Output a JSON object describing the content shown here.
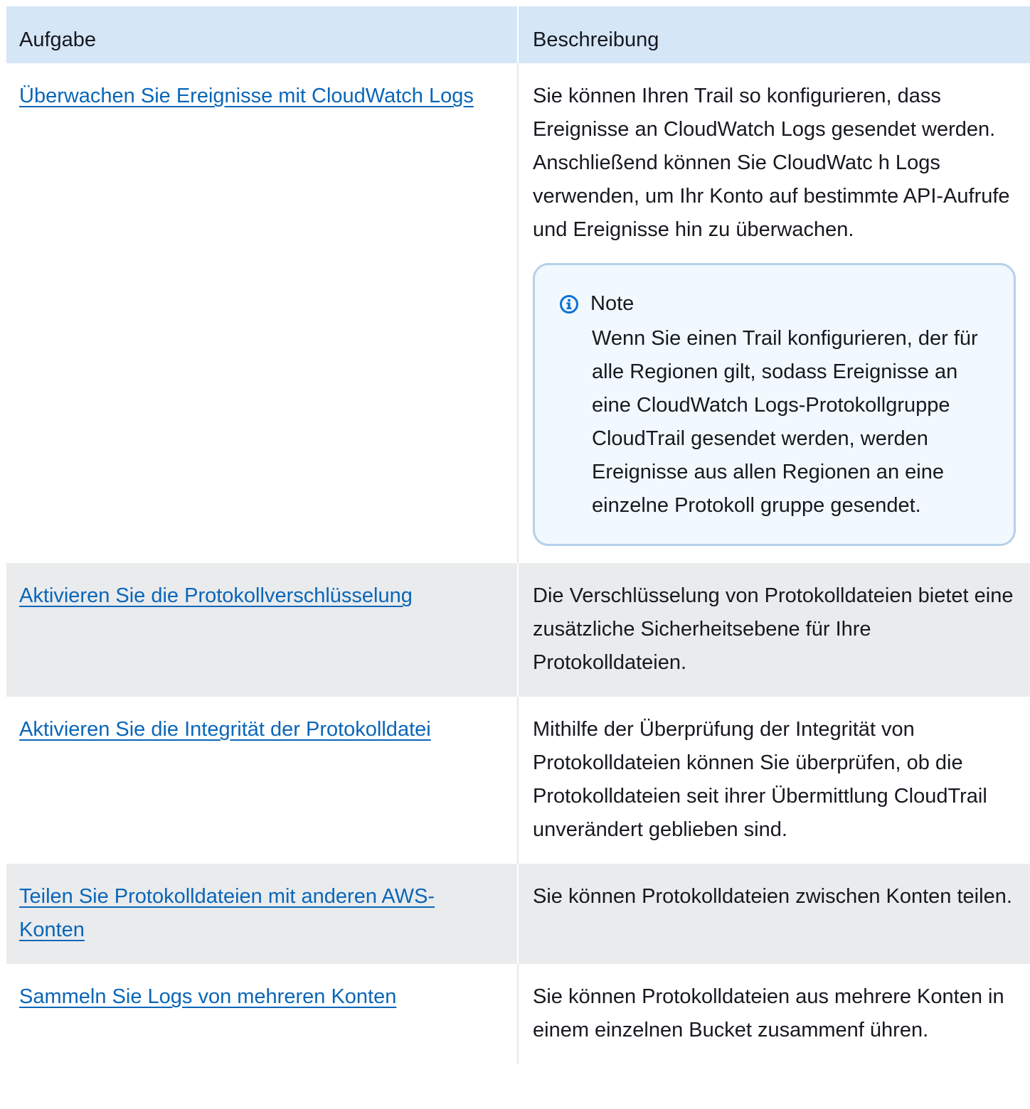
{
  "table": {
    "headers": {
      "task": "Aufgabe",
      "description": "Beschreibung"
    },
    "rows": [
      {
        "task": "Überwachen Sie Ereignisse mit CloudWatch Logs",
        "description": "Sie können Ihren Trail so konfigurieren, dass Ereignisse an CloudWatch Logs gesendet werden. Anschließend können Sie CloudWatc h Logs verwenden, um Ihr Konto auf bestimmte API-Aufrufe und Ereignisse hin zu überwachen.",
        "note": {
          "title": "Note",
          "body": "Wenn Sie einen Trail konfigurieren, der für alle Regionen gilt, sodass Ereignisse an eine CloudWatch Logs-Protokollgruppe CloudTrail gesendet werden, werden Ereignisse aus allen Regionen an eine einzelne Protokoll gruppe gesendet."
        }
      },
      {
        "task": "Aktivieren Sie die Protokollverschlüsselung",
        "description": "Die Verschlüsselung von Protokolldateien bietet eine zusätzliche Sicherheitsebene für Ihre Protokolldateien."
      },
      {
        "task": "Aktivieren Sie die Integrität der Protokolldatei",
        "description": "Mithilfe der Überprüfung der Integrität von Protokolldateien können Sie überprüfen, ob die Protokolldateien seit ihrer Übermittlung CloudTrail unverändert geblieben sind."
      },
      {
        "task": "Teilen Sie Protokolldateien mit anderen AWS-Konten",
        "description": "Sie können Protokolldateien zwischen Konten teilen."
      },
      {
        "task": "Sammeln Sie Logs von mehreren Konten",
        "description": "Sie können Protokolldateien aus mehrere Konten in einem einzelnen Bucket zusammenf ühren."
      }
    ]
  },
  "colors": {
    "header_bg": "#d5e6f7",
    "row_alt_bg": "#e9ebed",
    "link": "#0a66b8",
    "note_bg": "#f1f8fe",
    "note_border": "#b5d0ea",
    "info_icon": "#0972d3"
  },
  "icons": {
    "note": "info-icon"
  }
}
